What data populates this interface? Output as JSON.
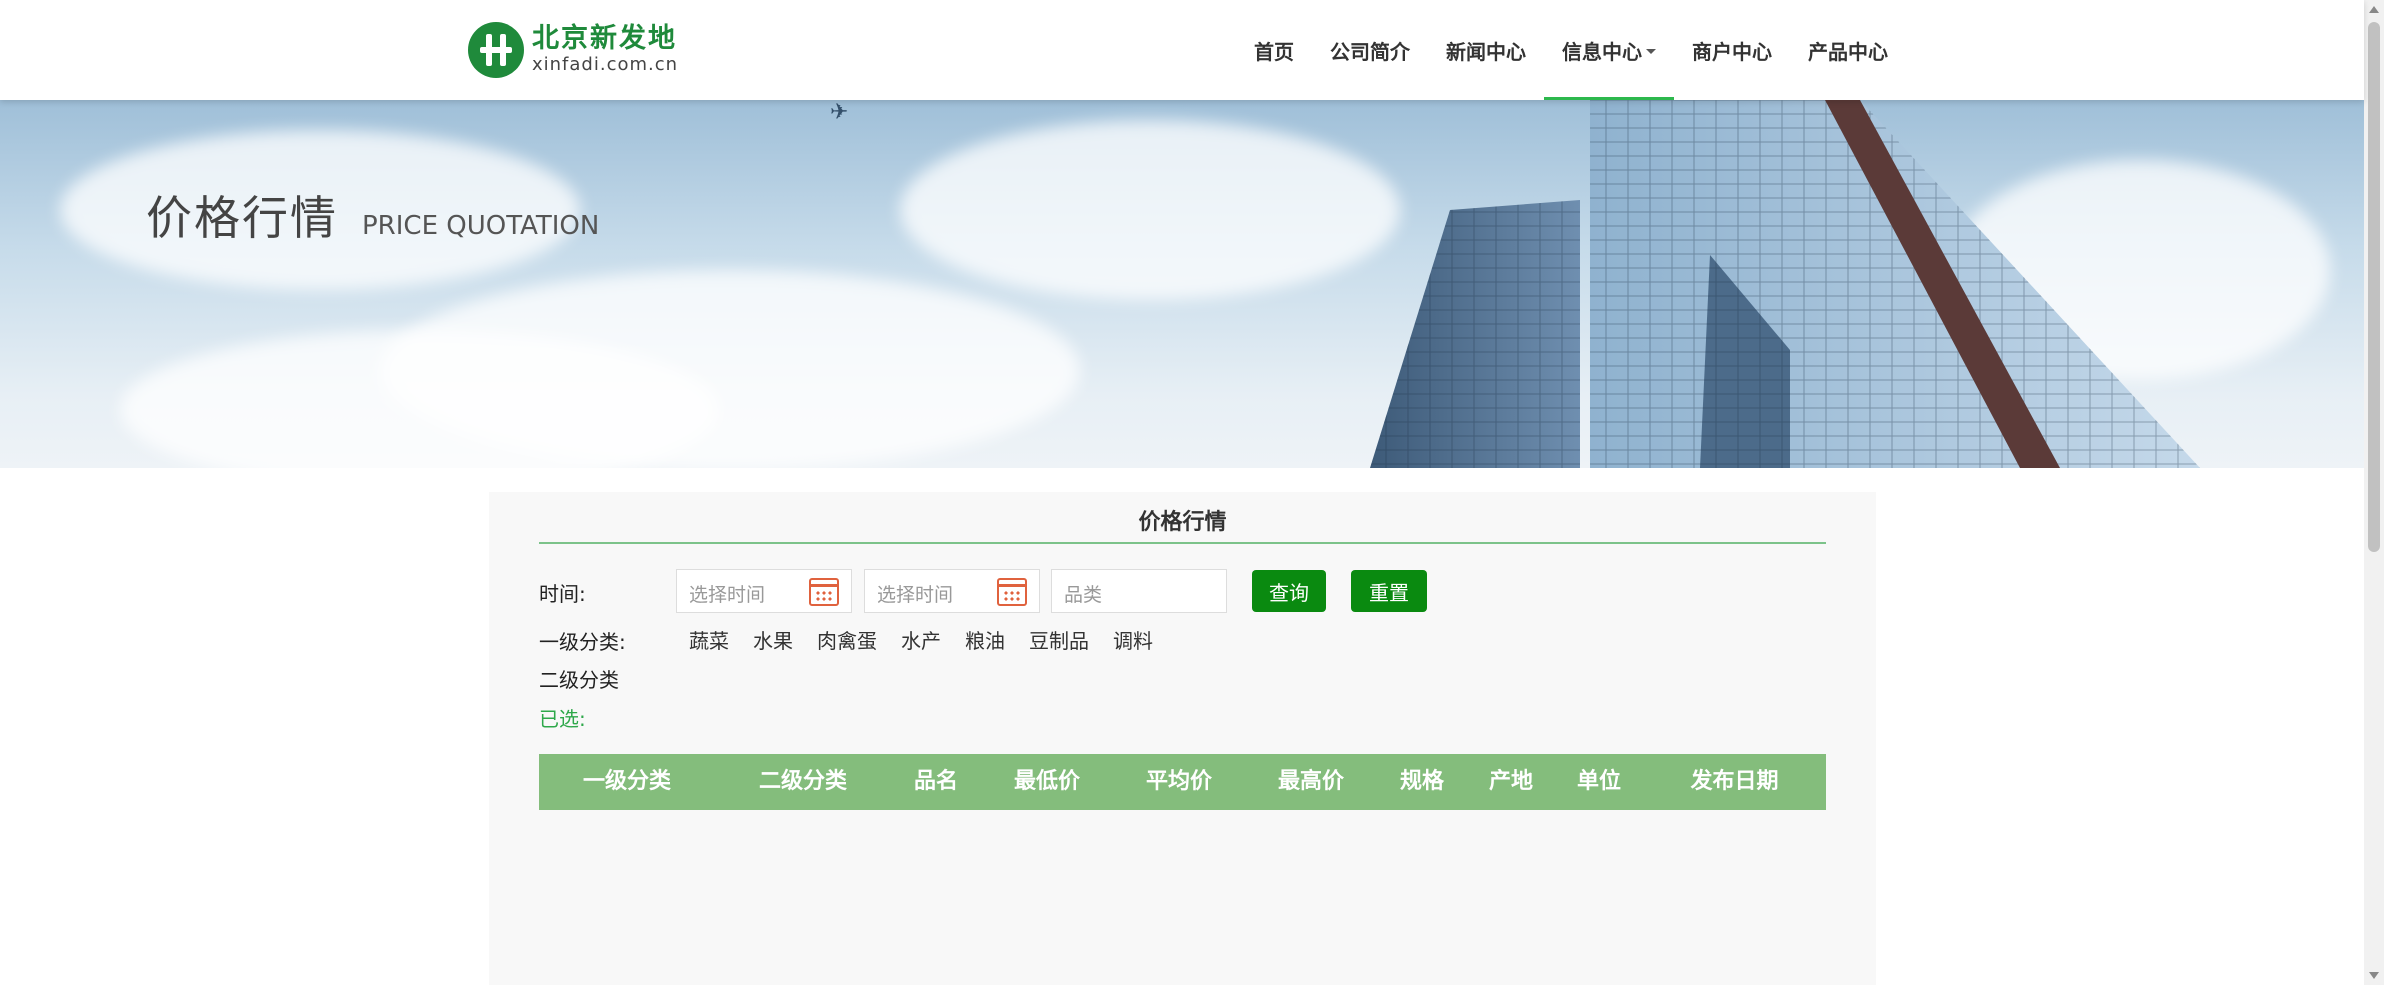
{
  "logo": {
    "name_cn": "北京新发地",
    "domain": "xinfadi.com.cn"
  },
  "nav": {
    "items": [
      {
        "label": "首页"
      },
      {
        "label": "公司简介"
      },
      {
        "label": "新闻中心"
      },
      {
        "label": "信息中心",
        "active": true,
        "dropdown": true
      },
      {
        "label": "商户中心"
      },
      {
        "label": "产品中心"
      }
    ]
  },
  "banner": {
    "title_cn": "价格行情",
    "title_en": "PRICE QUOTATION"
  },
  "panel": {
    "title": "价格行情",
    "time_label": "时间:",
    "start_date_placeholder": "选择时间",
    "end_date_placeholder": "选择时间",
    "category_placeholder": "品类",
    "query_button": "查询",
    "reset_button": "重置",
    "level1_label": "一级分类:",
    "level1_items": [
      "蔬菜",
      "水果",
      "肉禽蛋",
      "水产",
      "粮油",
      "豆制品",
      "调料"
    ],
    "level2_label": "二级分类",
    "selected_label": "已选:"
  },
  "table": {
    "headers": [
      "一级分类",
      "二级分类",
      "品名",
      "最低价",
      "平均价",
      "最高价",
      "规格",
      "产地",
      "单位",
      "发布日期"
    ]
  },
  "colors": {
    "brand_green": "#1f8a3b",
    "button_green": "#0a8a10",
    "table_head": "#84bd7c",
    "nav_active": "#2db84d"
  }
}
